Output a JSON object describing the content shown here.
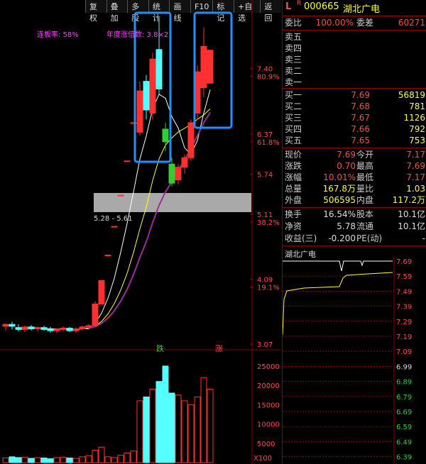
{
  "toolbar": [
    "复权",
    "叠加",
    "多股",
    "统计",
    "画线",
    "F10",
    "标记",
    "+自选",
    "返回"
  ],
  "chart_annotations": {
    "limit_rate": "连板率: 58%",
    "annual_gain": "年度涨倍数: 3.8×2",
    "zone_label": "5.28 - 5.61",
    "die_label": "跌",
    "zhang_label": "涨",
    "vol_unit": "X100"
  },
  "price_axis": [
    {
      "label": "7.40",
      "color": "#ff4a4a",
      "y_value": 7.4
    },
    {
      "label": "80.9%",
      "color": "#ff4a4a",
      "y_value": 7.28
    },
    {
      "label": "6.37",
      "color": "#ff4a4a",
      "y_value": 6.37
    },
    {
      "label": "61.8%",
      "color": "#ff4a4a",
      "y_value": 6.25
    },
    {
      "label": "5.74",
      "color": "#ff4a4a",
      "y_value": 5.74
    },
    {
      "label": "5.11",
      "color": "#ff4a4a",
      "y_value": 5.11
    },
    {
      "label": "38.2%",
      "color": "#ff4a4a",
      "y_value": 4.99
    },
    {
      "label": "4.09",
      "color": "#ff4a4a",
      "y_value": 4.09
    },
    {
      "label": "19.1%",
      "color": "#ff4a4a",
      "y_value": 3.97
    },
    {
      "label": "3.07",
      "color": "#ff4a4a",
      "y_value": 3.07
    }
  ],
  "volume_axis": [
    "25000",
    "20000",
    "15000",
    "10000",
    "5000"
  ],
  "quote": {
    "marker": "L",
    "flag": "R",
    "code": "000665",
    "name": "湖北广电",
    "weibi_label": "委比",
    "weibi": "100.00%",
    "weicha_label": "委差",
    "weicha": "60271",
    "asks": [
      {
        "label": "卖五",
        "price": "",
        "vol": ""
      },
      {
        "label": "卖四",
        "price": "",
        "vol": ""
      },
      {
        "label": "卖三",
        "price": "",
        "vol": ""
      },
      {
        "label": "卖二",
        "price": "",
        "vol": ""
      },
      {
        "label": "卖一",
        "price": "",
        "vol": ""
      }
    ],
    "bids": [
      {
        "label": "买一",
        "price": "7.69",
        "vol": "56819"
      },
      {
        "label": "买二",
        "price": "7.68",
        "vol": "781"
      },
      {
        "label": "买三",
        "price": "7.67",
        "vol": "1126"
      },
      {
        "label": "买四",
        "price": "7.66",
        "vol": "792"
      },
      {
        "label": "买五",
        "price": "7.65",
        "vol": "753"
      }
    ],
    "stats": [
      {
        "l1": "现价",
        "v1": "7.69",
        "l2": "今开",
        "v2": "7.17"
      },
      {
        "l1": "涨跌",
        "v1": "0.70",
        "l2": "最高",
        "v2": "7.69"
      },
      {
        "l1": "涨幅",
        "v1": "10.01%",
        "l2": "最低",
        "v2": "7.17"
      },
      {
        "l1": "总量",
        "v1": "167.8万",
        "l2": "量比",
        "v2": "1.03"
      },
      {
        "l1": "外盘",
        "v1": "506595",
        "l2": "内盘",
        "v2": "117.2万"
      }
    ],
    "stats2": [
      {
        "l1": "换手",
        "v1": "16.54%",
        "l2": "股本",
        "v2": "10.1亿"
      },
      {
        "l1": "净资",
        "v1": "5.78",
        "l2": "流通",
        "v2": "10.1亿"
      },
      {
        "l1": "收益(三)",
        "v1": "-0.200",
        "l2": "PE(动)",
        "v2": "-"
      }
    ]
  },
  "intraday": {
    "title": "湖北广电",
    "axis": [
      {
        "label": "7.69",
        "color": "#ff4a4a"
      },
      {
        "label": "7.59",
        "color": "#ff4a4a"
      },
      {
        "label": "7.49",
        "color": "#ff4a4a"
      },
      {
        "label": "7.39",
        "color": "#ff4a4a"
      },
      {
        "label": "7.29",
        "color": "#ff4a4a"
      },
      {
        "label": "7.19",
        "color": "#ff4a4a"
      },
      {
        "label": "7.09",
        "color": "#ff4a4a"
      },
      {
        "label": "6.99",
        "color": "#dddddd"
      },
      {
        "label": "6.89",
        "color": "#33cc33"
      },
      {
        "label": "6.79",
        "color": "#33cc33"
      },
      {
        "label": "6.69",
        "color": "#33cc33"
      },
      {
        "label": "6.59",
        "color": "#33cc33"
      },
      {
        "label": "6.49",
        "color": "#33cc33"
      },
      {
        "label": "6.39",
        "color": "#33cc33"
      }
    ]
  },
  "chart_data": {
    "type": "candlestick",
    "candles": [
      {
        "o": 3.35,
        "h": 3.4,
        "l": 3.28,
        "c": 3.38,
        "dir": "up"
      },
      {
        "o": 3.38,
        "h": 3.42,
        "l": 3.3,
        "c": 3.35,
        "dir": "down"
      },
      {
        "o": 3.33,
        "h": 3.38,
        "l": 3.27,
        "c": 3.3,
        "dir": "down"
      },
      {
        "o": 3.3,
        "h": 3.36,
        "l": 3.26,
        "c": 3.34,
        "dir": "up"
      },
      {
        "o": 3.34,
        "h": 3.37,
        "l": 3.28,
        "c": 3.31,
        "dir": "down"
      },
      {
        "o": 3.31,
        "h": 3.35,
        "l": 3.27,
        "c": 3.33,
        "dir": "up"
      },
      {
        "o": 3.33,
        "h": 3.36,
        "l": 3.28,
        "c": 3.3,
        "dir": "down"
      },
      {
        "o": 3.3,
        "h": 3.34,
        "l": 3.25,
        "c": 3.28,
        "dir": "down"
      },
      {
        "o": 3.28,
        "h": 3.32,
        "l": 3.24,
        "c": 3.3,
        "dir": "up"
      },
      {
        "o": 3.3,
        "h": 3.35,
        "l": 3.27,
        "c": 3.32,
        "dir": "up"
      },
      {
        "o": 3.32,
        "h": 3.34,
        "l": 3.26,
        "c": 3.28,
        "dir": "down"
      },
      {
        "o": 3.28,
        "h": 3.33,
        "l": 3.25,
        "c": 3.31,
        "dir": "up"
      },
      {
        "o": 3.31,
        "h": 3.36,
        "l": 3.28,
        "c": 3.34,
        "dir": "up"
      },
      {
        "o": 3.34,
        "h": 3.38,
        "l": 3.3,
        "c": 3.36,
        "dir": "up"
      },
      {
        "o": 3.36,
        "h": 3.74,
        "l": 3.35,
        "c": 3.7,
        "dir": "up"
      },
      {
        "o": 3.7,
        "h": 4.07,
        "l": 3.7,
        "c": 4.07,
        "dir": "up"
      },
      {
        "o": 4.47,
        "h": 4.47,
        "l": 4.47,
        "c": 4.47,
        "dir": "up"
      },
      {
        "o": 4.92,
        "h": 4.92,
        "l": 4.92,
        "c": 4.92,
        "dir": "up"
      },
      {
        "o": 5.41,
        "h": 5.41,
        "l": 5.41,
        "c": 5.41,
        "dir": "up"
      },
      {
        "o": 5.95,
        "h": 5.95,
        "l": 5.95,
        "c": 5.95,
        "dir": "up"
      },
      {
        "o": 6.55,
        "h": 6.55,
        "l": 6.55,
        "c": 6.55,
        "dir": "up"
      },
      {
        "o": 6.4,
        "h": 7.2,
        "l": 6.35,
        "c": 7.05,
        "dir": "up"
      },
      {
        "o": 7.2,
        "h": 7.3,
        "l": 6.6,
        "c": 6.75,
        "dir": "down"
      },
      {
        "o": 6.7,
        "h": 7.65,
        "l": 6.6,
        "c": 7.55,
        "dir": "up"
      },
      {
        "o": 7.7,
        "h": 8.2,
        "l": 7.0,
        "c": 7.08,
        "dir": "down"
      },
      {
        "o": 6.45,
        "h": 6.55,
        "l": 6.1,
        "c": 6.25,
        "dir": "down"
      },
      {
        "o": 5.9,
        "h": 6.0,
        "l": 5.55,
        "c": 5.6,
        "dir": "down"
      },
      {
        "o": 5.65,
        "h": 5.9,
        "l": 5.58,
        "c": 5.85,
        "dir": "up"
      },
      {
        "o": 5.85,
        "h": 6.05,
        "l": 5.75,
        "c": 6.0,
        "dir": "up"
      },
      {
        "o": 6.0,
        "h": 6.6,
        "l": 5.95,
        "c": 6.55,
        "dir": "up"
      },
      {
        "o": 6.7,
        "h": 7.45,
        "l": 6.6,
        "c": 7.35,
        "dir": "up"
      },
      {
        "o": 7.1,
        "h": 8.05,
        "l": 6.95,
        "c": 7.75,
        "dir": "up"
      },
      {
        "o": 7.17,
        "h": 7.69,
        "l": 7.17,
        "c": 7.69,
        "dir": "up"
      }
    ],
    "volume": [
      1200,
      1500,
      1300,
      1400,
      1100,
      1300,
      1200,
      1000,
      1300,
      1400,
      1200,
      1100,
      1500,
      1800,
      3200,
      4000,
      1500,
      1300,
      1900,
      2500,
      3000,
      16000,
      17000,
      19000,
      21000,
      25000,
      18000,
      17500,
      16000,
      15000,
      17000,
      22000,
      19000
    ],
    "ylim": [
      3.07,
      8.2
    ],
    "vol_max": 27000
  },
  "colors": {
    "up": "#ff3030",
    "down": "#54ffff",
    "green_candle": "#33cc33",
    "highlight": "#1e90ff"
  }
}
